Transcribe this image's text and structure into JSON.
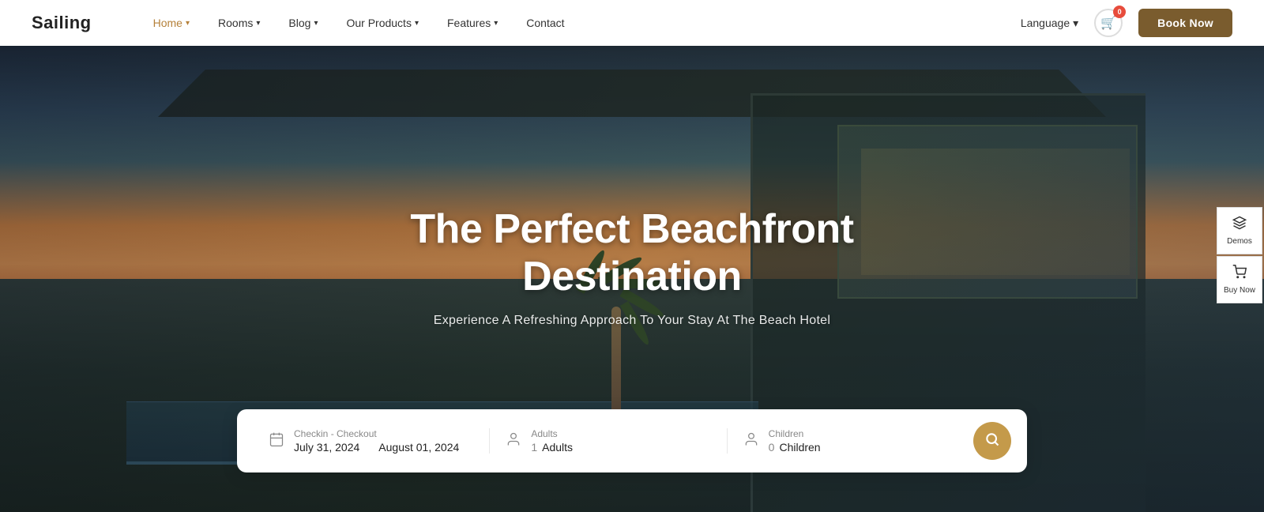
{
  "brand": "Sailing",
  "nav": {
    "items": [
      {
        "label": "Home",
        "active": true,
        "hasDropdown": true
      },
      {
        "label": "Rooms",
        "active": false,
        "hasDropdown": true
      },
      {
        "label": "Blog",
        "active": false,
        "hasDropdown": true
      },
      {
        "label": "Our Products",
        "active": false,
        "hasDropdown": true
      },
      {
        "label": "Features",
        "active": false,
        "hasDropdown": true
      },
      {
        "label": "Contact",
        "active": false,
        "hasDropdown": false
      }
    ],
    "language_label": "Language",
    "cart_count": "0",
    "book_now": "Book Now"
  },
  "hero": {
    "title": "The Perfect Beachfront Destination",
    "subtitle": "Experience A Refreshing Approach To Your Stay At The Beach Hotel"
  },
  "search": {
    "checkin_label": "Checkin - Checkout",
    "checkin_date": "July 31, 2024",
    "checkout_date": "August 01, 2024",
    "adults_label": "Adults",
    "adults_count": "1",
    "adults_placeholder": "Adults",
    "children_label": "Children",
    "children_count": "0",
    "children_placeholder": "Children"
  },
  "side_panel": {
    "demos_label": "Demos",
    "buy_label": "Buy Now"
  }
}
